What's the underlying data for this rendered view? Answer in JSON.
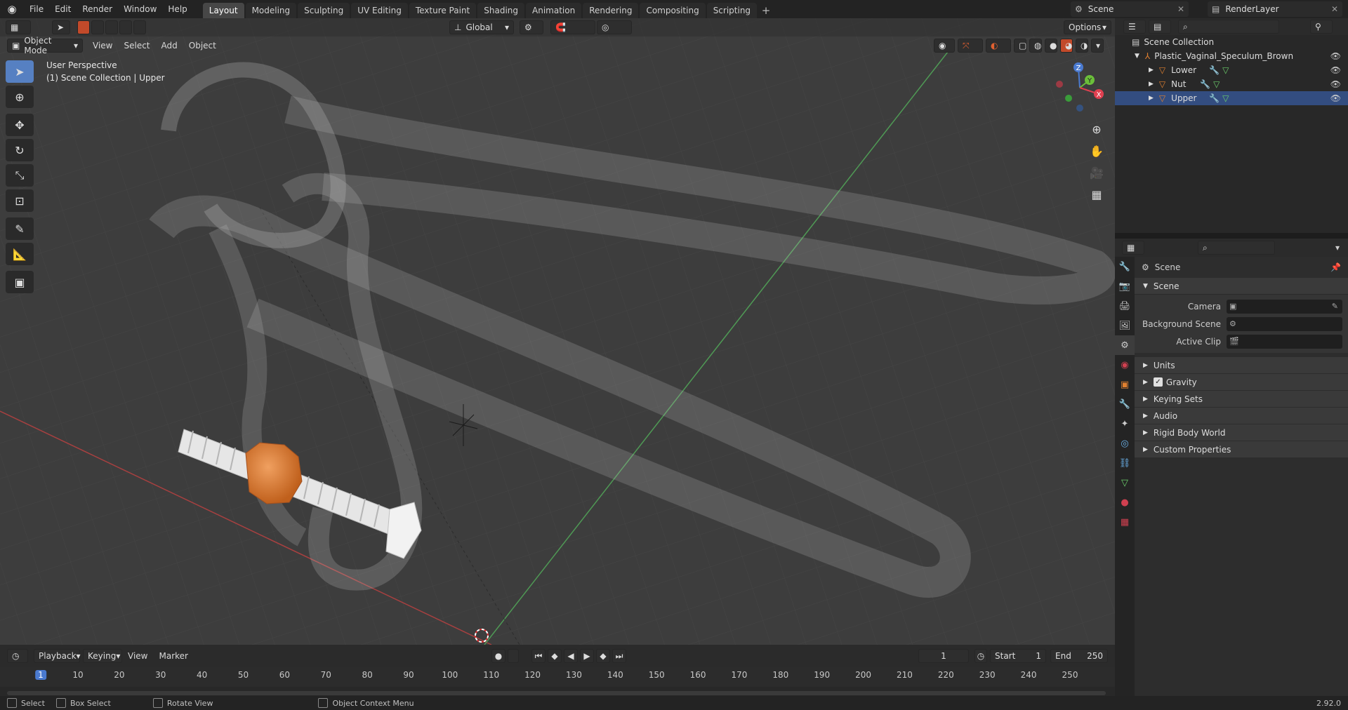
{
  "topbar": {
    "menus": [
      "File",
      "Edit",
      "Render",
      "Window",
      "Help"
    ],
    "workspaces": [
      "Layout",
      "Modeling",
      "Sculpting",
      "UV Editing",
      "Texture Paint",
      "Shading",
      "Animation",
      "Rendering",
      "Compositing",
      "Scripting"
    ],
    "active_workspace": "Layout",
    "scene_name": "Scene",
    "view_layer": "RenderLayer"
  },
  "viewport": {
    "mode": "Object Mode",
    "menus": [
      "View",
      "Select",
      "Add",
      "Object"
    ],
    "orientation": "Global",
    "options_label": "Options",
    "info_line1": "User Perspective",
    "info_line2": "(1) Scene Collection | Upper",
    "gizmo_axes": [
      "Z",
      "Y",
      "X"
    ]
  },
  "outliner": {
    "root": "Scene Collection",
    "collection": "Plastic_Vaginal_Speculum_Brown",
    "objects": [
      "Lower",
      "Nut",
      "Upper"
    ]
  },
  "properties": {
    "context": "Scene",
    "panel": "Scene",
    "fields": [
      {
        "label": "Camera"
      },
      {
        "label": "Background Scene"
      },
      {
        "label": "Active Clip"
      }
    ],
    "subpanels": [
      "Units",
      "Gravity",
      "Keying Sets",
      "Audio",
      "Rigid Body World",
      "Custom Properties"
    ],
    "gravity_checked": true
  },
  "timeline": {
    "menus": [
      "Playback",
      "Keying",
      "View",
      "Marker"
    ],
    "current_frame": "1",
    "start_label": "Start",
    "start": "1",
    "end_label": "End",
    "end": "250",
    "ticks": [
      "1",
      "10",
      "20",
      "30",
      "40",
      "50",
      "60",
      "70",
      "80",
      "90",
      "100",
      "110",
      "120",
      "130",
      "140",
      "150",
      "160",
      "170",
      "180",
      "190",
      "200",
      "210",
      "220",
      "230",
      "240",
      "250"
    ]
  },
  "statusbar": {
    "select": "Select",
    "box_select": "Box Select",
    "rotate_view": "Rotate View",
    "context_menu": "Object Context Menu",
    "version": "2.92.0"
  }
}
